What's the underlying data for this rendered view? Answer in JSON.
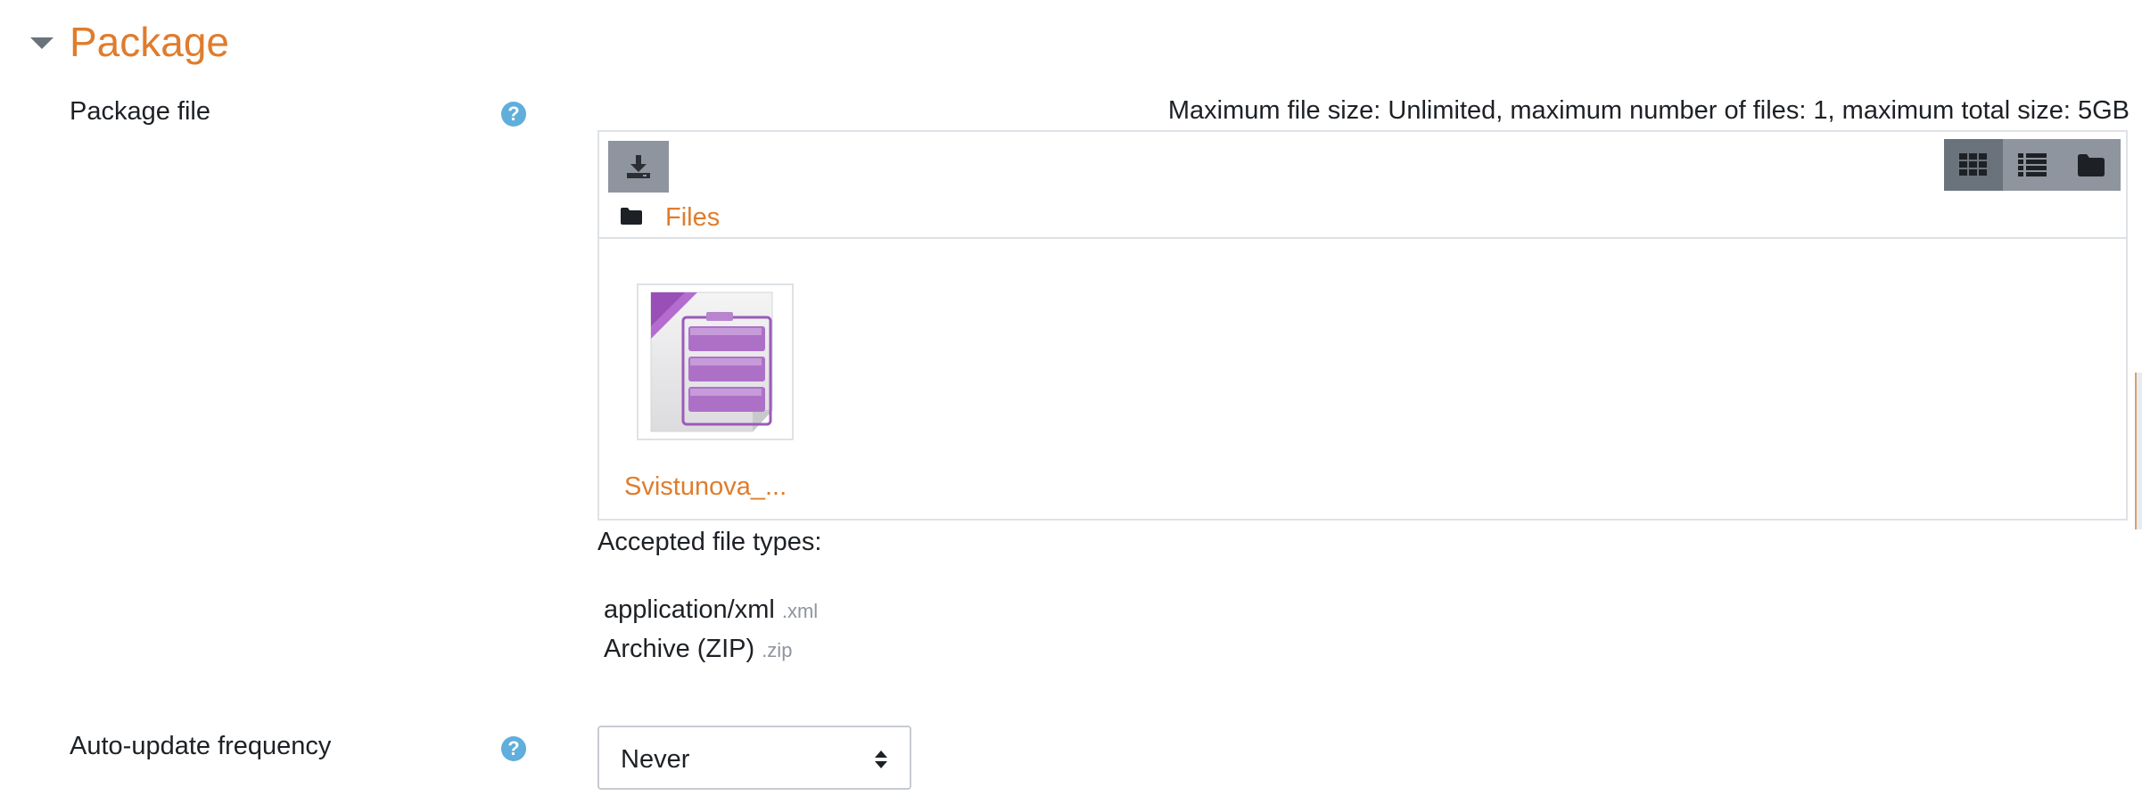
{
  "section": {
    "title": "Package"
  },
  "package_file": {
    "label": "Package file",
    "max_info": "Maximum file size: Unlimited, maximum number of files: 1, maximum total size: 5GB",
    "path": "Files",
    "file_name": "Svistunova_..."
  },
  "accepted": {
    "label": "Accepted file types:",
    "types": [
      {
        "name": "application/xml",
        "ext": ".xml"
      },
      {
        "name": "Archive (ZIP)",
        "ext": ".zip"
      }
    ]
  },
  "auto_update": {
    "label": "Auto-update frequency",
    "value": "Never"
  },
  "colors": {
    "accent": "#e07c2c",
    "help": "#5faedb",
    "button": "#8f959e",
    "button_active": "#6a737b"
  },
  "icons": {
    "collapse": "chevron-down-icon",
    "help": "question-circle-icon",
    "download": "download-icon",
    "grid_view": "grid-icon",
    "list_view": "list-icon",
    "tree_view": "folder-icon",
    "folder": "folder-icon",
    "file": "zip-archive-file-icon",
    "select": "sort-caret-icon"
  }
}
